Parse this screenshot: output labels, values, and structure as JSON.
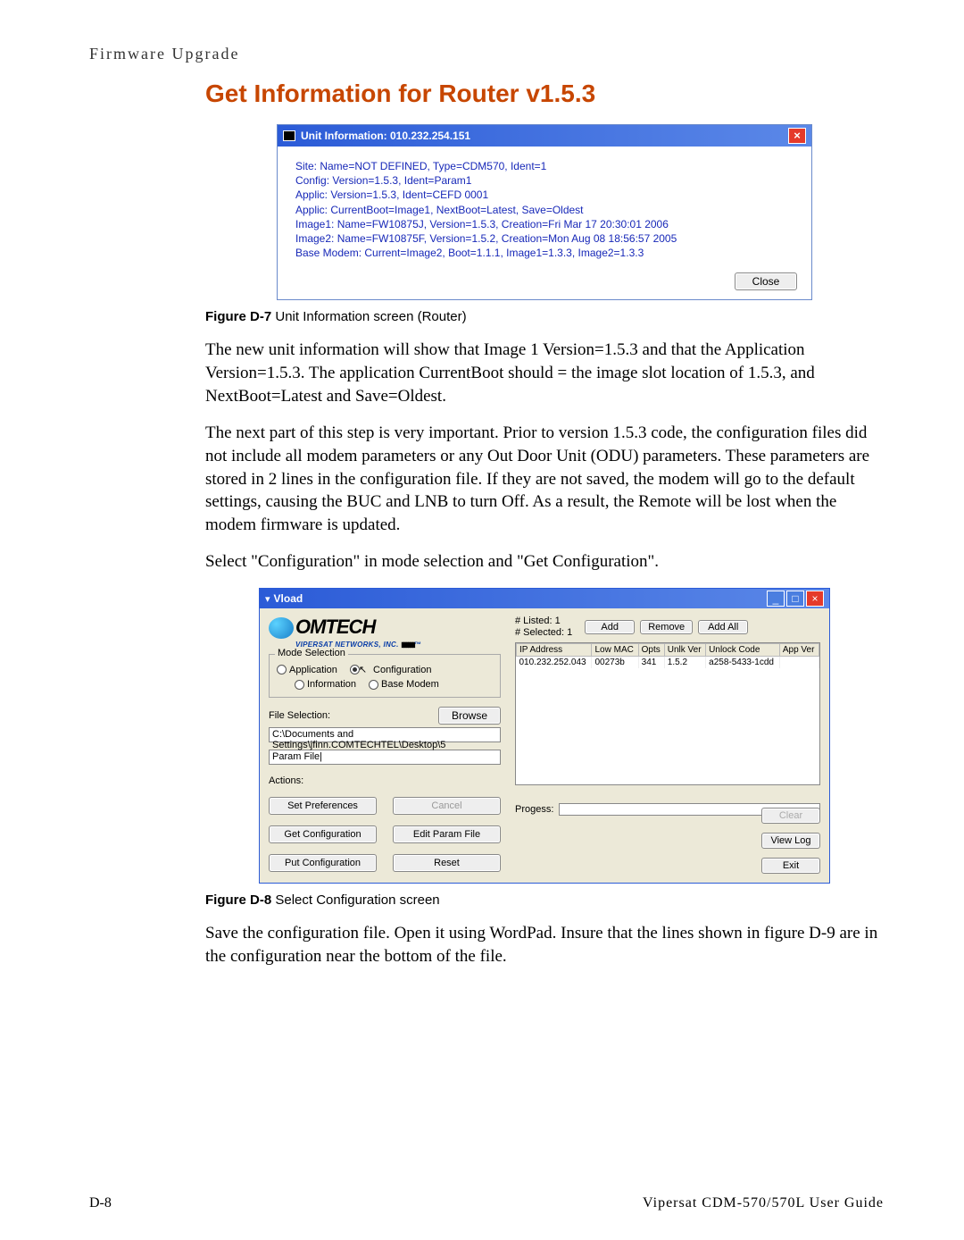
{
  "running_head": "Firmware Upgrade",
  "title": "Get Information for Router v1.5.3",
  "dialog1": {
    "title": "Unit Information: 010.232.254.151",
    "lines": [
      "Site: Name=NOT DEFINED, Type=CDM570, Ident=1",
      "Config: Version=1.5.3, Ident=Param1",
      "Applic: Version=1.5.3, Ident=CEFD 0001",
      "Applic: CurrentBoot=Image1, NextBoot=Latest, Save=Oldest",
      "Image1: Name=FW10875J, Version=1.5.3, Creation=Fri Mar 17 20:30:01 2006",
      "Image2: Name=FW10875F, Version=1.5.2, Creation=Mon Aug 08 18:56:57 2005",
      "Base Modem: Current=Image2, Boot=1.1.1, Image1=1.3.3, Image2=1.3.3"
    ],
    "close_btn": "Close"
  },
  "fig1": {
    "bold": "Figure D-7",
    "rest": "   Unit Information screen (Router)"
  },
  "para1": "The new unit information will show that Image 1 Version=1.5.3 and that the Application Version=1.5.3. The application CurrentBoot should = the image slot location of 1.5.3, and NextBoot=Latest and Save=Oldest.",
  "para2": "The next part of this step is very important. Prior to version 1.5.3 code, the configuration files did not include all modem parameters or any Out Door Unit (ODU) parameters. These parameters are stored in 2 lines in the configuration file. If they are not saved, the modem will go to the default settings, causing the BUC and LNB to turn Off. As a result, the Remote will be lost when the modem firmware is updated.",
  "para3": "Select \"Configuration\" in mode selection and \"Get Configuration\".",
  "vload": {
    "title": "Vload",
    "logo_main": "OMTECH",
    "logo_sub": "VIPERSAT NETWORKS, INC.",
    "mode_legend": "Mode Selection",
    "radios": {
      "application": "Application",
      "configuration": "Configuration",
      "information": "Information",
      "basemodem": "Base Modem"
    },
    "file_label": "File Selection:",
    "browse": "Browse",
    "file_path": "C:\\Documents and Settings\\jfinn.COMTECHTEL\\Desktop\\5",
    "param_box": "Param File|",
    "actions_label": "Actions:",
    "buttons": {
      "set_pref": "Set Preferences",
      "cancel": "Cancel",
      "get_conf": "Get Configuration",
      "edit_param": "Edit Param File",
      "put_conf": "Put Configuration",
      "reset": "Reset"
    },
    "counts": {
      "listed": "# Listed: 1",
      "selected": "# Selected: 1"
    },
    "top_btns": {
      "add": "Add",
      "remove": "Remove",
      "addall": "Add All"
    },
    "columns": [
      "IP Address",
      "Low MAC",
      "Opts",
      "Unlk Ver",
      "Unlock Code",
      "App Ver"
    ],
    "row": [
      "010.232.252.043",
      "00273b",
      "341",
      "1.5.2",
      "a258-5433-1cdd",
      ""
    ],
    "progress_label": "Progess:",
    "side_btns": {
      "clear": "Clear",
      "viewlog": "View Log",
      "exit": "Exit"
    }
  },
  "fig2": {
    "bold": "Figure D-8",
    "rest": "   Select Configuration screen"
  },
  "para4": "Save the configuration file. Open it using WordPad. Insure that the lines shown in figure D-9 are in the configuration near the bottom of the file.",
  "footer": {
    "page": "D-8",
    "guide": "Vipersat CDM-570/570L User Guide"
  }
}
